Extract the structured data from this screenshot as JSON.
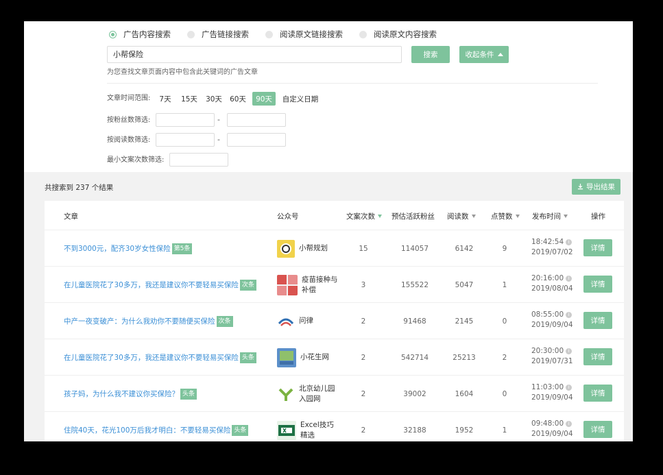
{
  "search": {
    "modes": [
      {
        "label": "广告内容搜索",
        "selected": true
      },
      {
        "label": "广告链接搜索",
        "selected": false
      },
      {
        "label": "阅读原文链接搜索",
        "selected": false
      },
      {
        "label": "阅读原文内容搜索",
        "selected": false
      }
    ],
    "keyword": "小帮保险",
    "search_button": "搜索",
    "collapse_button": "收起条件",
    "hint": "为您查找文章页面内容中包含此关键词的广告文章"
  },
  "filters": {
    "time_range_label": "文章时间范围:",
    "time_options": [
      "7天",
      "15天",
      "30天",
      "60天",
      "90天",
      "自定义日期"
    ],
    "time_selected": "90天",
    "fans_label": "按粉丝数筛选:",
    "reads_label": "按阅读数筛选:",
    "min_count_label": "最小文案次数筛选:",
    "range_sep": "-"
  },
  "results": {
    "total_text": "共搜索到 237 个结果",
    "export_button": "导出结果",
    "columns": {
      "article": "文章",
      "account": "公众号",
      "copy_count": "文案次数",
      "active_fans": "预估活跃粉丝",
      "reads": "阅读数",
      "likes": "点赞数",
      "publish_time": "发布时间",
      "action": "操作"
    },
    "rows": [
      {
        "title": "不到3000元，配齐30岁女性保险",
        "tag": "第5条",
        "account": "小帮规划",
        "copy_count": "15",
        "active_fans": "114057",
        "reads": "6142",
        "likes": "9",
        "time": "18:42:54",
        "date": "2019/07/02",
        "action": "详情"
      },
      {
        "title": "在儿童医院花了30多万，我还是建议你不要轻易买保险",
        "tag": "次条",
        "account": "疫苗接种与补偿",
        "copy_count": "3",
        "active_fans": "155522",
        "reads": "5047",
        "likes": "1",
        "time": "20:16:00",
        "date": "2019/08/04",
        "action": "详情"
      },
      {
        "title": "中产一夜变破产：为什么我劝你不要随便买保险",
        "tag": "次条",
        "account": "问律",
        "copy_count": "2",
        "active_fans": "91468",
        "reads": "2145",
        "likes": "0",
        "time": "08:55:00",
        "date": "2019/09/04",
        "action": "详情"
      },
      {
        "title": "在儿童医院花了30多万，我还是建议你不要轻易买保险",
        "tag": "头条",
        "account": "小花生网",
        "copy_count": "2",
        "active_fans": "542714",
        "reads": "25213",
        "likes": "2",
        "time": "20:30:00",
        "date": "2019/07/31",
        "action": "详情"
      },
      {
        "title": "孩子妈，为什么我不建议你买保险？",
        "tag": "头条",
        "account": "北京幼儿园入园网",
        "copy_count": "2",
        "active_fans": "39002",
        "reads": "1604",
        "likes": "0",
        "time": "11:03:00",
        "date": "2019/09/04",
        "action": "详情"
      },
      {
        "title": "住院40天，花光100万后我才明白：不要轻易买保险",
        "tag": "头条",
        "account": "Excel技巧精选",
        "copy_count": "2",
        "active_fans": "32188",
        "reads": "1952",
        "likes": "1",
        "time": "09:48:00",
        "date": "2019/09/04",
        "action": "详情"
      }
    ]
  },
  "colors": {
    "accent": "#7ec39c",
    "link": "#3b8fd6"
  },
  "icons": [
    "radio-icon",
    "caret-up-icon",
    "download-icon",
    "sort-caret-icon",
    "info-icon"
  ]
}
